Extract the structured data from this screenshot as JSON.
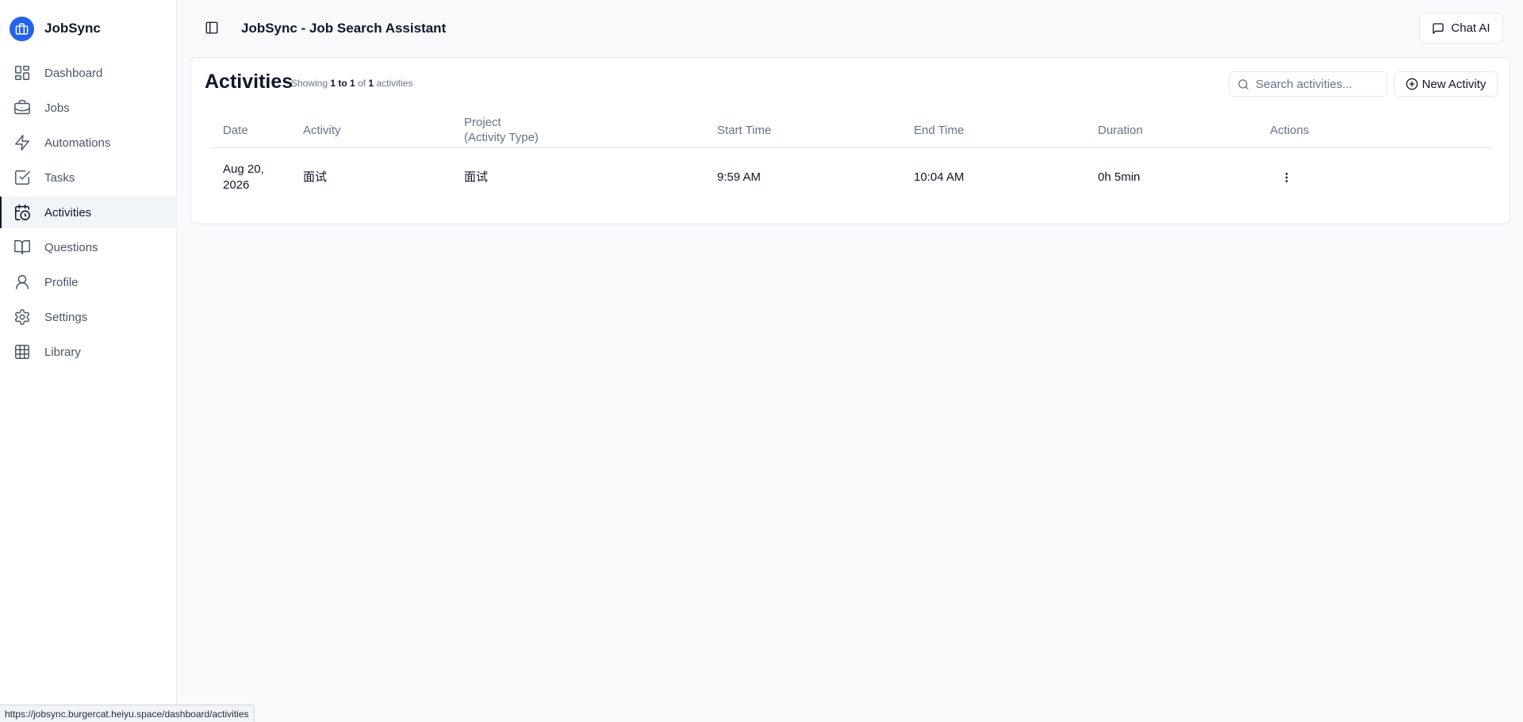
{
  "app": {
    "name": "JobSync",
    "header_title": "JobSync - Job Search Assistant",
    "chat_button_label": "Chat AI"
  },
  "sidebar": {
    "items": [
      {
        "label": "Dashboard",
        "icon": "dashboard-icon"
      },
      {
        "label": "Jobs",
        "icon": "briefcase-icon"
      },
      {
        "label": "Automations",
        "icon": "zap-icon"
      },
      {
        "label": "Tasks",
        "icon": "check-square-icon"
      },
      {
        "label": "Activities",
        "icon": "calendar-clock-icon",
        "active": true
      },
      {
        "label": "Questions",
        "icon": "book-open-icon"
      },
      {
        "label": "Profile",
        "icon": "user-icon"
      },
      {
        "label": "Settings",
        "icon": "settings-icon"
      },
      {
        "label": "Library",
        "icon": "table-icon"
      }
    ]
  },
  "activities": {
    "title": "Activities",
    "showing_prefix": "Showing",
    "range": "1 to 1",
    "of_text": "of",
    "total": "1",
    "suffix": "activities",
    "search_placeholder": "Search activities...",
    "new_button_label": "New Activity",
    "columns": {
      "date": "Date",
      "activity": "Activity",
      "project_line1": "Project",
      "project_line2": "(Activity Type)",
      "start_time": "Start Time",
      "end_time": "End Time",
      "duration": "Duration",
      "actions": "Actions"
    },
    "rows": [
      {
        "date_line1": "Aug 20,",
        "date_line2": "2026",
        "activity": "面试",
        "project": "面试",
        "start_time": "9:59 AM",
        "end_time": "10:04 AM",
        "duration": "0h 5min"
      }
    ]
  },
  "status_url": "https://jobsync.burgercat.heiyu.space/dashboard/activities",
  "colors": {
    "brand": "#2563eb",
    "background": "#f8fafc",
    "muted_text": "#64748b",
    "border": "#e2e8f0"
  }
}
